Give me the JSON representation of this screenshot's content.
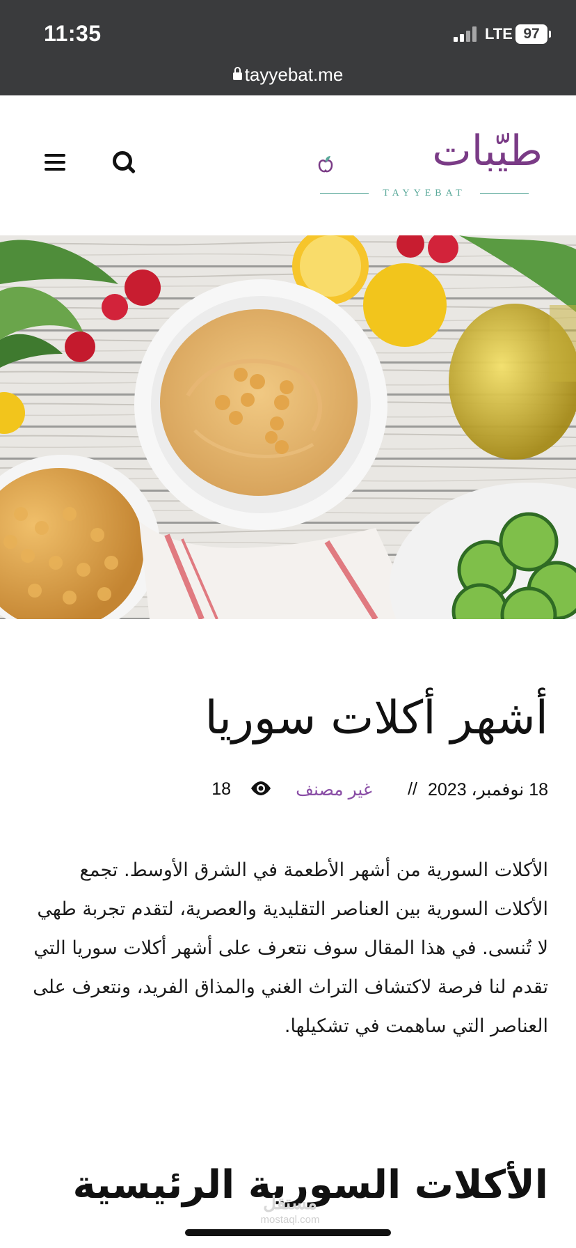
{
  "status_bar": {
    "time": "11:35",
    "network": "LTE",
    "battery": "97"
  },
  "browser": {
    "url": "tayyebat.me"
  },
  "header": {
    "logo_ar": "طيّبات",
    "logo_en": "TAYYEBAT",
    "menu_icon": "hamburger-menu-icon",
    "search_icon": "search-icon"
  },
  "hero": {
    "icon": "hummus-photo"
  },
  "article": {
    "title": "أشهر أكلات سوريا",
    "date": "18 نوفمبر، 2023",
    "separator": "//",
    "category": "غير مصنف",
    "views": "18",
    "body": "الأكلات السورية من أشهر الأطعمة في الشرق الأوسط. تجمع الأكلات السورية بين العناصر التقليدية والعصرية، لتقدم تجربة طهي لا تُنسى. في هذا المقال سوف نتعرف على أشهر أكلات سوريا التي تقدم لنا فرصة لاكتشاف التراث الغني والمذاق الفريد، ونتعرف على العناصر التي ساهمت في تشكيلها.",
    "subheading": "الأكلات السورية الرئيسية"
  },
  "watermark": {
    "ar": "مستقل",
    "en": "mostaql.com"
  },
  "colors": {
    "status_bg": "#3a3b3d",
    "brand_purple": "#7a3b86",
    "brand_teal": "#5aa99a",
    "category": "#8a4ea6"
  }
}
